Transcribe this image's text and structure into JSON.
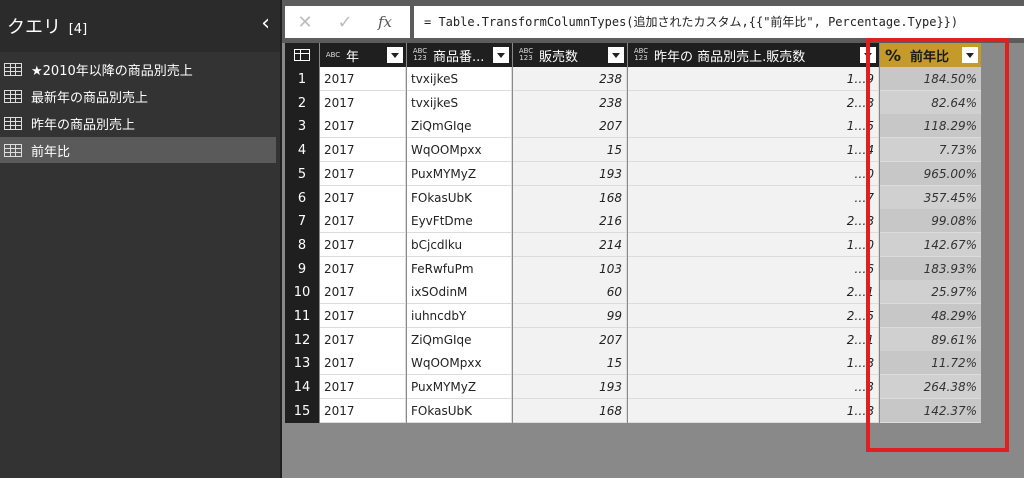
{
  "pane": {
    "title": "クエリ",
    "count": "[4]",
    "collapse_glyph": "‹",
    "items": [
      {
        "label": "★2010年以降の商品別売上",
        "selected": false
      },
      {
        "label": "最新年の商品別売上",
        "selected": false
      },
      {
        "label": "昨年の商品別売上",
        "selected": false
      },
      {
        "label": "前年比",
        "selected": true
      }
    ]
  },
  "formula": {
    "cancel": "✕",
    "commit": "✓",
    "fx": "fx",
    "text": "= Table.TransformColumnTypes(追加されたカスタム,{{\"前年比\", Percentage.Type}})"
  },
  "grid": {
    "columns": [
      {
        "type_icon": "ABC",
        "label": "年"
      },
      {
        "type_icon": "ABC 123",
        "label": "商品番..."
      },
      {
        "type_icon": "ABC 123",
        "label": "販売数"
      },
      {
        "type_icon": "ABC 123",
        "label": "昨年の 商品別売上.販売数"
      },
      {
        "type_icon": "%",
        "label": "前年比"
      }
    ],
    "rows": [
      {
        "n": "1",
        "year": "2017",
        "product": "tvxijkeS",
        "sales": "238",
        "prev": "1…9",
        "yoy": "184.50%"
      },
      {
        "n": "2",
        "year": "2017",
        "product": "tvxijkeS",
        "sales": "238",
        "prev": "2…8",
        "yoy": "82.64%"
      },
      {
        "n": "3",
        "year": "2017",
        "product": "ZiQmGIqe",
        "sales": "207",
        "prev": "1…5",
        "yoy": "118.29%"
      },
      {
        "n": "4",
        "year": "2017",
        "product": "WqOOMpxx",
        "sales": "15",
        "prev": "1…4",
        "yoy": "7.73%"
      },
      {
        "n": "5",
        "year": "2017",
        "product": "PuxMYMyZ",
        "sales": "193",
        "prev": "…0",
        "yoy": "965.00%"
      },
      {
        "n": "6",
        "year": "2017",
        "product": "FOkasUbK",
        "sales": "168",
        "prev": "…7",
        "yoy": "357.45%"
      },
      {
        "n": "7",
        "year": "2017",
        "product": "EyvFtDme",
        "sales": "216",
        "prev": "2…8",
        "yoy": "99.08%"
      },
      {
        "n": "8",
        "year": "2017",
        "product": "bCjcdlku",
        "sales": "214",
        "prev": "1…0",
        "yoy": "142.67%"
      },
      {
        "n": "9",
        "year": "2017",
        "product": "FeRwfuPm",
        "sales": "103",
        "prev": "…6",
        "yoy": "183.93%"
      },
      {
        "n": "10",
        "year": "2017",
        "product": "ixSOdinM",
        "sales": "60",
        "prev": "2…1",
        "yoy": "25.97%"
      },
      {
        "n": "11",
        "year": "2017",
        "product": "iuhncdbY",
        "sales": "99",
        "prev": "2…5",
        "yoy": "48.29%"
      },
      {
        "n": "12",
        "year": "2017",
        "product": "ZiQmGIqe",
        "sales": "207",
        "prev": "2…1",
        "yoy": "89.61%"
      },
      {
        "n": "13",
        "year": "2017",
        "product": "WqOOMpxx",
        "sales": "15",
        "prev": "1…8",
        "yoy": "11.72%"
      },
      {
        "n": "14",
        "year": "2017",
        "product": "PuxMYMyZ",
        "sales": "193",
        "prev": "…3",
        "yoy": "264.38%"
      },
      {
        "n": "15",
        "year": "2017",
        "product": "FOkasUbK",
        "sales": "168",
        "prev": "1…8",
        "yoy": "142.37%"
      }
    ]
  },
  "colors": {
    "accent_pct_header": "#c49a2a",
    "highlight": "#e02020"
  }
}
